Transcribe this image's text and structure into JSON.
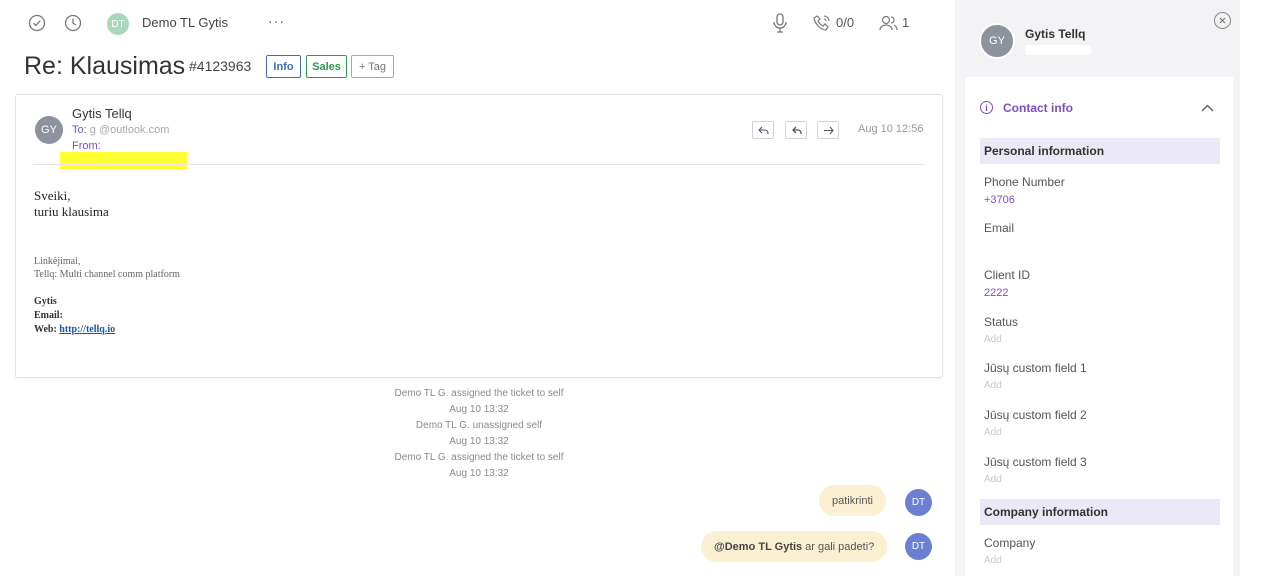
{
  "topbar": {
    "agent_initials": "DT",
    "agent_name": "Demo TL Gytis",
    "more_label": "···",
    "calls_count": "0/0",
    "watchers_count": "1"
  },
  "ticket": {
    "subject": "Re: Klausimas",
    "id": "#4123963",
    "tags": [
      "Info",
      "Sales"
    ],
    "add_tag_label": "+ Tag"
  },
  "message": {
    "sender_initials": "GY",
    "sender_name": "Gytis Tellq",
    "to_label": "To:",
    "to_value": "g        @outlook.com",
    "from_label": "From:",
    "from_value": "   ",
    "date": "Aug 10 12:56",
    "body_line1": "Sveiki,",
    "body_line2": "turiu klausima",
    "sig_line1": "Linkėjimai,",
    "sig_line2": "Tellq: Multi channel comm platform",
    "sig_name_label": "Gytis",
    "sig_email_label": "Email:",
    "sig_web_label": "Web:",
    "sig_web_link": "http://tellq.io"
  },
  "activity": [
    {
      "text": "Demo TL G. assigned the ticket to self",
      "time": "Aug 10 13:32"
    },
    {
      "text": "Demo TL G. unassigned self",
      "time": "Aug 10 13:32"
    },
    {
      "text": "Demo TL G. assigned the ticket to self",
      "time": "Aug 10 13:32"
    }
  ],
  "notes": [
    {
      "text": "patikrinti",
      "avatar": "DT"
    },
    {
      "mention": "@Demo TL Gytis",
      "text": "ar gali padeti?",
      "avatar": "DT"
    }
  ],
  "contact": {
    "initials": "GY",
    "name": "Gytis Tellq",
    "section_title": "Contact info",
    "personal_header": "Personal information",
    "company_header": "Company information",
    "add_label": "Add",
    "fields": {
      "phone_label": "Phone Number",
      "phone_value": "+3706",
      "email_label": "Email",
      "client_id_label": "Client ID",
      "client_id_value": "2222",
      "status_label": "Status",
      "custom1_label": "Jūsų custom field 1",
      "custom2_label": "Jūsų custom field 2",
      "custom3_label": "Jūsų custom field 3",
      "company_label": "Company"
    }
  },
  "colors": {
    "accent": "#7b4ec9",
    "note_bubble": "#fbf1d2",
    "avatar_blue": "#6b7fd4",
    "highlight": "#ffff33"
  }
}
